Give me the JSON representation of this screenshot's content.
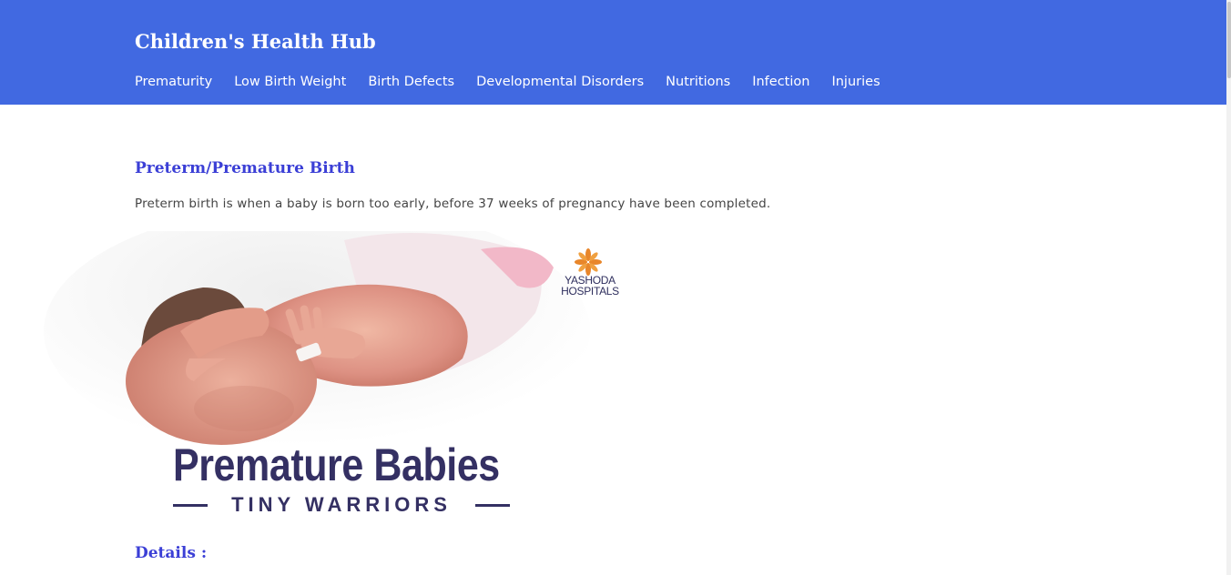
{
  "header": {
    "site_title": "Children's Health Hub",
    "nav": [
      "Prematurity",
      "Low Birth Weight",
      "Birth Defects",
      "Developmental Disorders",
      "Nutritions",
      "Infection",
      "Injuries"
    ]
  },
  "main": {
    "section_title": "Preterm/Premature Birth",
    "section_text": "Preterm birth is when a baby is born too early, before 37 weeks of pregnancy have been completed.",
    "banner": {
      "heading": "Premature Babies",
      "subheading": "TINY WARRIORS",
      "logo_line1": "YASHODA",
      "logo_line2": "HOSPITALS"
    },
    "details_title": "Details :"
  },
  "colors": {
    "header_bg": "#4169e1",
    "heading_color": "#3b3fd6",
    "banner_text": "#343063",
    "logo_accent": "#e8862a"
  }
}
